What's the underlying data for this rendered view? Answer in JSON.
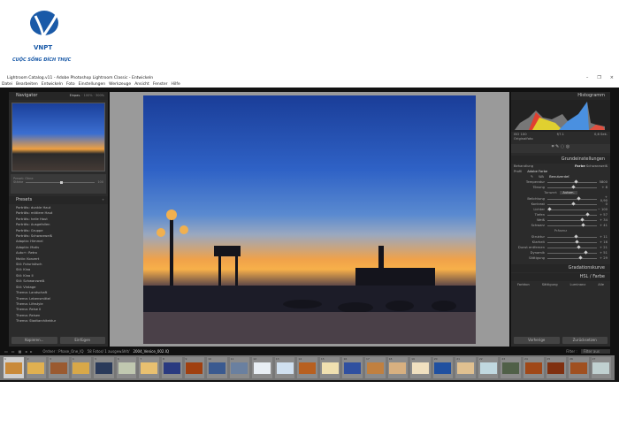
{
  "brand": {
    "name": "VNPT",
    "slogan": "CUỘC SỐNG ĐÍCH THỰC"
  },
  "window": {
    "title": "Lightroom Catalog.v11 - Adobe Photoshop Lightroom Classic - Entwickeln",
    "controls": [
      "–",
      "❐",
      "×"
    ]
  },
  "menu": [
    "Datei",
    "Bearbeiten",
    "Entwickeln",
    "Foto",
    "Einstellungen",
    "Werkzeuge",
    "Ansicht",
    "Fenster",
    "Hilfe"
  ],
  "navigator": {
    "title": "Navigator",
    "zoom": [
      "Einpas.",
      "100%",
      "300%"
    ]
  },
  "preset_amount": {
    "label": "Preset: Ohne",
    "slider_label": "Stärke",
    "value": "100"
  },
  "presets": {
    "title": "Presets",
    "items": [
      "Porträts: dunkle Haut",
      "Porträts: mittlere Haut",
      "Porträts: helle Haut",
      "Porträts: Ausgefallen",
      "Porträts: Gruppe",
      "Porträts: Schwarzweiß",
      "Adaptiv: Himmel",
      "Adaptiv: Motiv",
      "Auto+: Retro",
      "Motiv: Konzert",
      "Stil: Futuristisch",
      "Stil: Kino",
      "Stil: Kino II",
      "Stil: Schwarzweiß",
      "Stil: Vintage",
      "Thema: Landschaft",
      "Thema: Lebensmittel",
      "Thema: Lifestyle",
      "Thema: Reise II",
      "Thema: Reisen",
      "Thema: Stadtarchitektur"
    ],
    "copy": "Kopieren...",
    "paste": "Einfügen"
  },
  "histogram": {
    "title": "Histogramm",
    "info": [
      "ISO 100",
      "f/7.1",
      "0,6 Sek."
    ],
    "original": "Originalfoto"
  },
  "basic": {
    "title": "Grundeinstellungen",
    "treatment_label": "Behandlung",
    "treatment": [
      "Farbe",
      "Schwarzweiß"
    ],
    "profile_label": "Profil",
    "profile": "Adobe Farbe",
    "wb_label": "WA",
    "wb": "Benutzerdef.",
    "wb_sliders": [
      {
        "label": "Temperatur",
        "value": "5800",
        "pos": 0.55
      },
      {
        "label": "Tönung",
        "value": "+ 8",
        "pos": 0.5
      }
    ],
    "tone_label": "Tonwert",
    "auto": "Autom.",
    "tone_sliders": [
      {
        "label": "Belichtung",
        "value": "+ 0,90",
        "pos": 0.6
      },
      {
        "label": "Kontrast",
        "value": "0",
        "pos": 0.5
      },
      {
        "label": "Lichter",
        "value": "− 100",
        "pos": 0.02
      },
      {
        "label": "Tiefen",
        "value": "+ 57",
        "pos": 0.78
      },
      {
        "label": "Weiß",
        "value": "+ 34",
        "pos": 0.67
      },
      {
        "label": "Schwarz",
        "value": "+ 41",
        "pos": 0.7
      }
    ],
    "presence_label": "Präsenz",
    "presence_sliders": [
      {
        "label": "Struktur",
        "value": "+ 11",
        "pos": 0.55
      },
      {
        "label": "Klarheit",
        "value": "+ 16",
        "pos": 0.58
      },
      {
        "label": "Dunst entfernen",
        "value": "+ 21",
        "pos": 0.6
      },
      {
        "label": "Dynamik",
        "value": "+ 51",
        "pos": 0.75
      },
      {
        "label": "Sättigung",
        "value": "+ 29",
        "pos": 0.64
      }
    ]
  },
  "tone_curve": {
    "title": "Gradationskurve"
  },
  "hsl": {
    "title": "HSL / Farbe",
    "tabs": [
      "Farbton",
      "Sättigung",
      "Luminanz",
      "Alle"
    ]
  },
  "bottom_buttons": {
    "previous": "Vorherige",
    "reset": "Zurücksetzen"
  },
  "filmstrip": {
    "source": "Ordner : Phase_One_IQ",
    "count": "58 Fotos/ 1 ausgewählt/",
    "selected": "2004_Venice_002.IQ",
    "filter_label": "Filter :",
    "filter_value": "Filter aus",
    "thumbs": [
      "#c98a3a",
      "#e0b050",
      "#9a5a30",
      "#d8a848",
      "#2a3a5a",
      "#c0c8b0",
      "#e8c070",
      "#2a3a80",
      "#a04010",
      "#3a5a90",
      "#6a80a0",
      "#e8eef4",
      "#d0e0f0",
      "#b86020",
      "#f0e0b0",
      "#3050a0",
      "#c08040",
      "#d8b080",
      "#f0e0c0",
      "#2050a0",
      "#e0c090",
      "#c0d8e0",
      "#506048",
      "#a04818",
      "#803010",
      "#a05020",
      "#c0d0d0"
    ]
  }
}
